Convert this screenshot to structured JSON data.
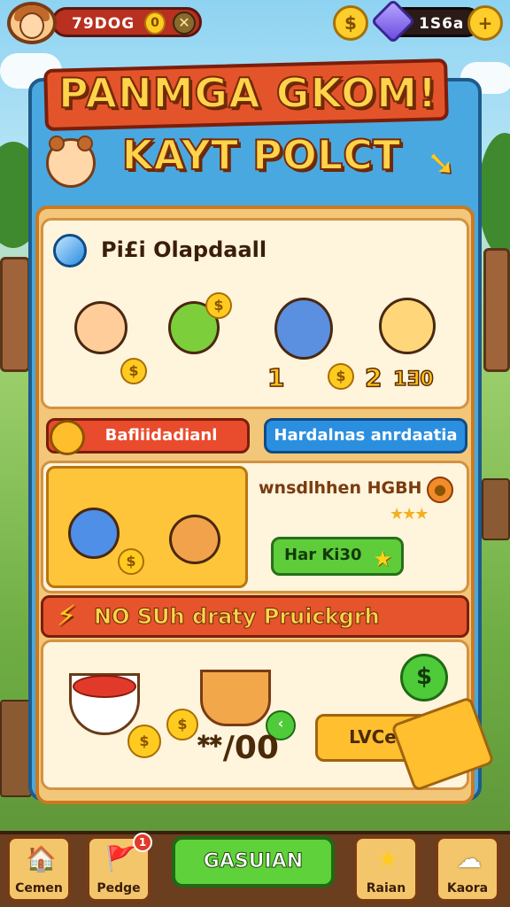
{
  "top_bar": {
    "currency_left": "79DOG",
    "coin_glyph": "0",
    "close_glyph": "✕",
    "dollar_glyph": "$",
    "gem_count": "1S6a",
    "plus_glyph": "+"
  },
  "title": {
    "line1": "PANMGA GKOM!",
    "line2": "KAYT POLCT"
  },
  "section1": {
    "heading": "Pi£i Olapdaall",
    "label_1": "1",
    "label_2": "2",
    "label_2b": "1Ǝ0"
  },
  "tabs": {
    "left": "Bafliidadianl",
    "right": "Hardalnas anrdaatia"
  },
  "promo": {
    "text": "wnsdlhhen HGBH",
    "stars": "★★★",
    "button_label": "Har Ki30"
  },
  "offer_banner": {
    "text": "NO SUh draty Pruickgrh"
  },
  "offer": {
    "price": "ᕯ/00",
    "button_label": "LVCe",
    "round_btn_glyph": "$"
  },
  "nav": {
    "items": [
      {
        "label": "Cemen",
        "icon": "house-icon"
      },
      {
        "label": "Pedge",
        "icon": "flag-icon"
      },
      {
        "label": "Raian",
        "icon": "star-icon"
      },
      {
        "label": "Kaora",
        "icon": "cloud-icon"
      }
    ],
    "main_label": "GASUIAN",
    "notif_count": "1"
  }
}
